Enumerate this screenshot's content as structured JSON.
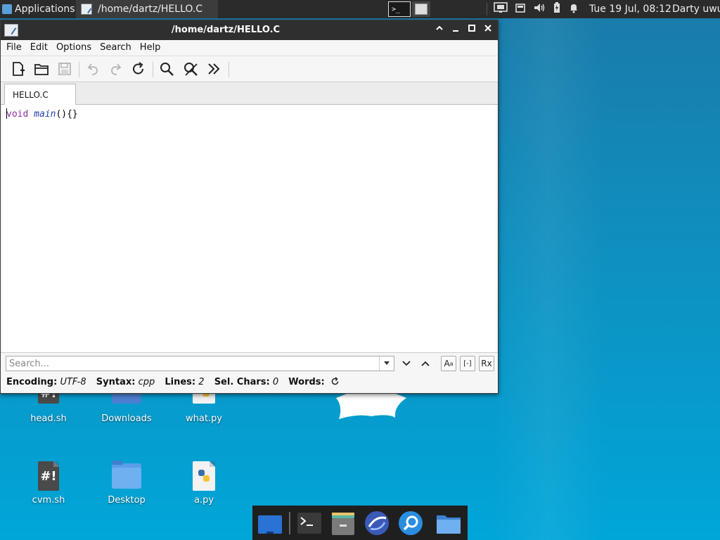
{
  "top_panel": {
    "apps_label": "Applications",
    "task_title": "/home/dartz/HELLO.C",
    "workspace_terminal_glyph": ">_",
    "clock": "Tue 19 Jul, 08:12",
    "user": "Darty uwu"
  },
  "window": {
    "title": "/home/dartz/HELLO.C",
    "controls": {
      "shade": "^",
      "minimize": "_",
      "maximize": "□",
      "close": "×"
    }
  },
  "menu": {
    "file": "File",
    "edit": "Edit",
    "options": "Options",
    "search": "Search",
    "help": "Help"
  },
  "toolbar": {
    "icons": [
      "new-file-icon",
      "open-folder-icon",
      "save-icon",
      "undo-icon",
      "redo-icon",
      "reload-icon",
      "find-icon",
      "replace-icon",
      "jump-icon"
    ]
  },
  "tab": {
    "label": "HELLO.C"
  },
  "editor": {
    "keyword": "void",
    "function": "main",
    "rest": "(){}"
  },
  "findbar": {
    "search_placeholder": "Search...",
    "match_case": "A",
    "whole_word": "[-]",
    "regex": "Rx"
  },
  "status": {
    "encoding_label": "Encoding:",
    "encoding_value": "UTF-8",
    "syntax_label": "Syntax:",
    "syntax_value": "cpp",
    "lines_label": "Lines:",
    "lines_value": "2",
    "selchars_label": "Sel. Chars:",
    "selchars_value": "0",
    "words_label": "Words:"
  },
  "desktop_icons": [
    {
      "label": "head.sh",
      "type": "script"
    },
    {
      "label": "Downloads",
      "type": "folder"
    },
    {
      "label": "what.py",
      "type": "python"
    },
    {
      "label": "cvm.sh",
      "type": "script"
    },
    {
      "label": "Desktop",
      "type": "folder"
    },
    {
      "label": "a.py",
      "type": "python"
    }
  ],
  "dock": {
    "items": [
      "show-desktop-icon",
      "terminal-icon",
      "file-manager-icon",
      "web-browser-icon",
      "app-finder-icon",
      "home-folder-icon"
    ]
  },
  "colors": {
    "desktop_top": "#1a7aa8",
    "desktop_bottom": "#00a6d8",
    "panel": "#2b2b2b",
    "keyword": "#8b2ea0",
    "function": "#1f3fa8"
  }
}
